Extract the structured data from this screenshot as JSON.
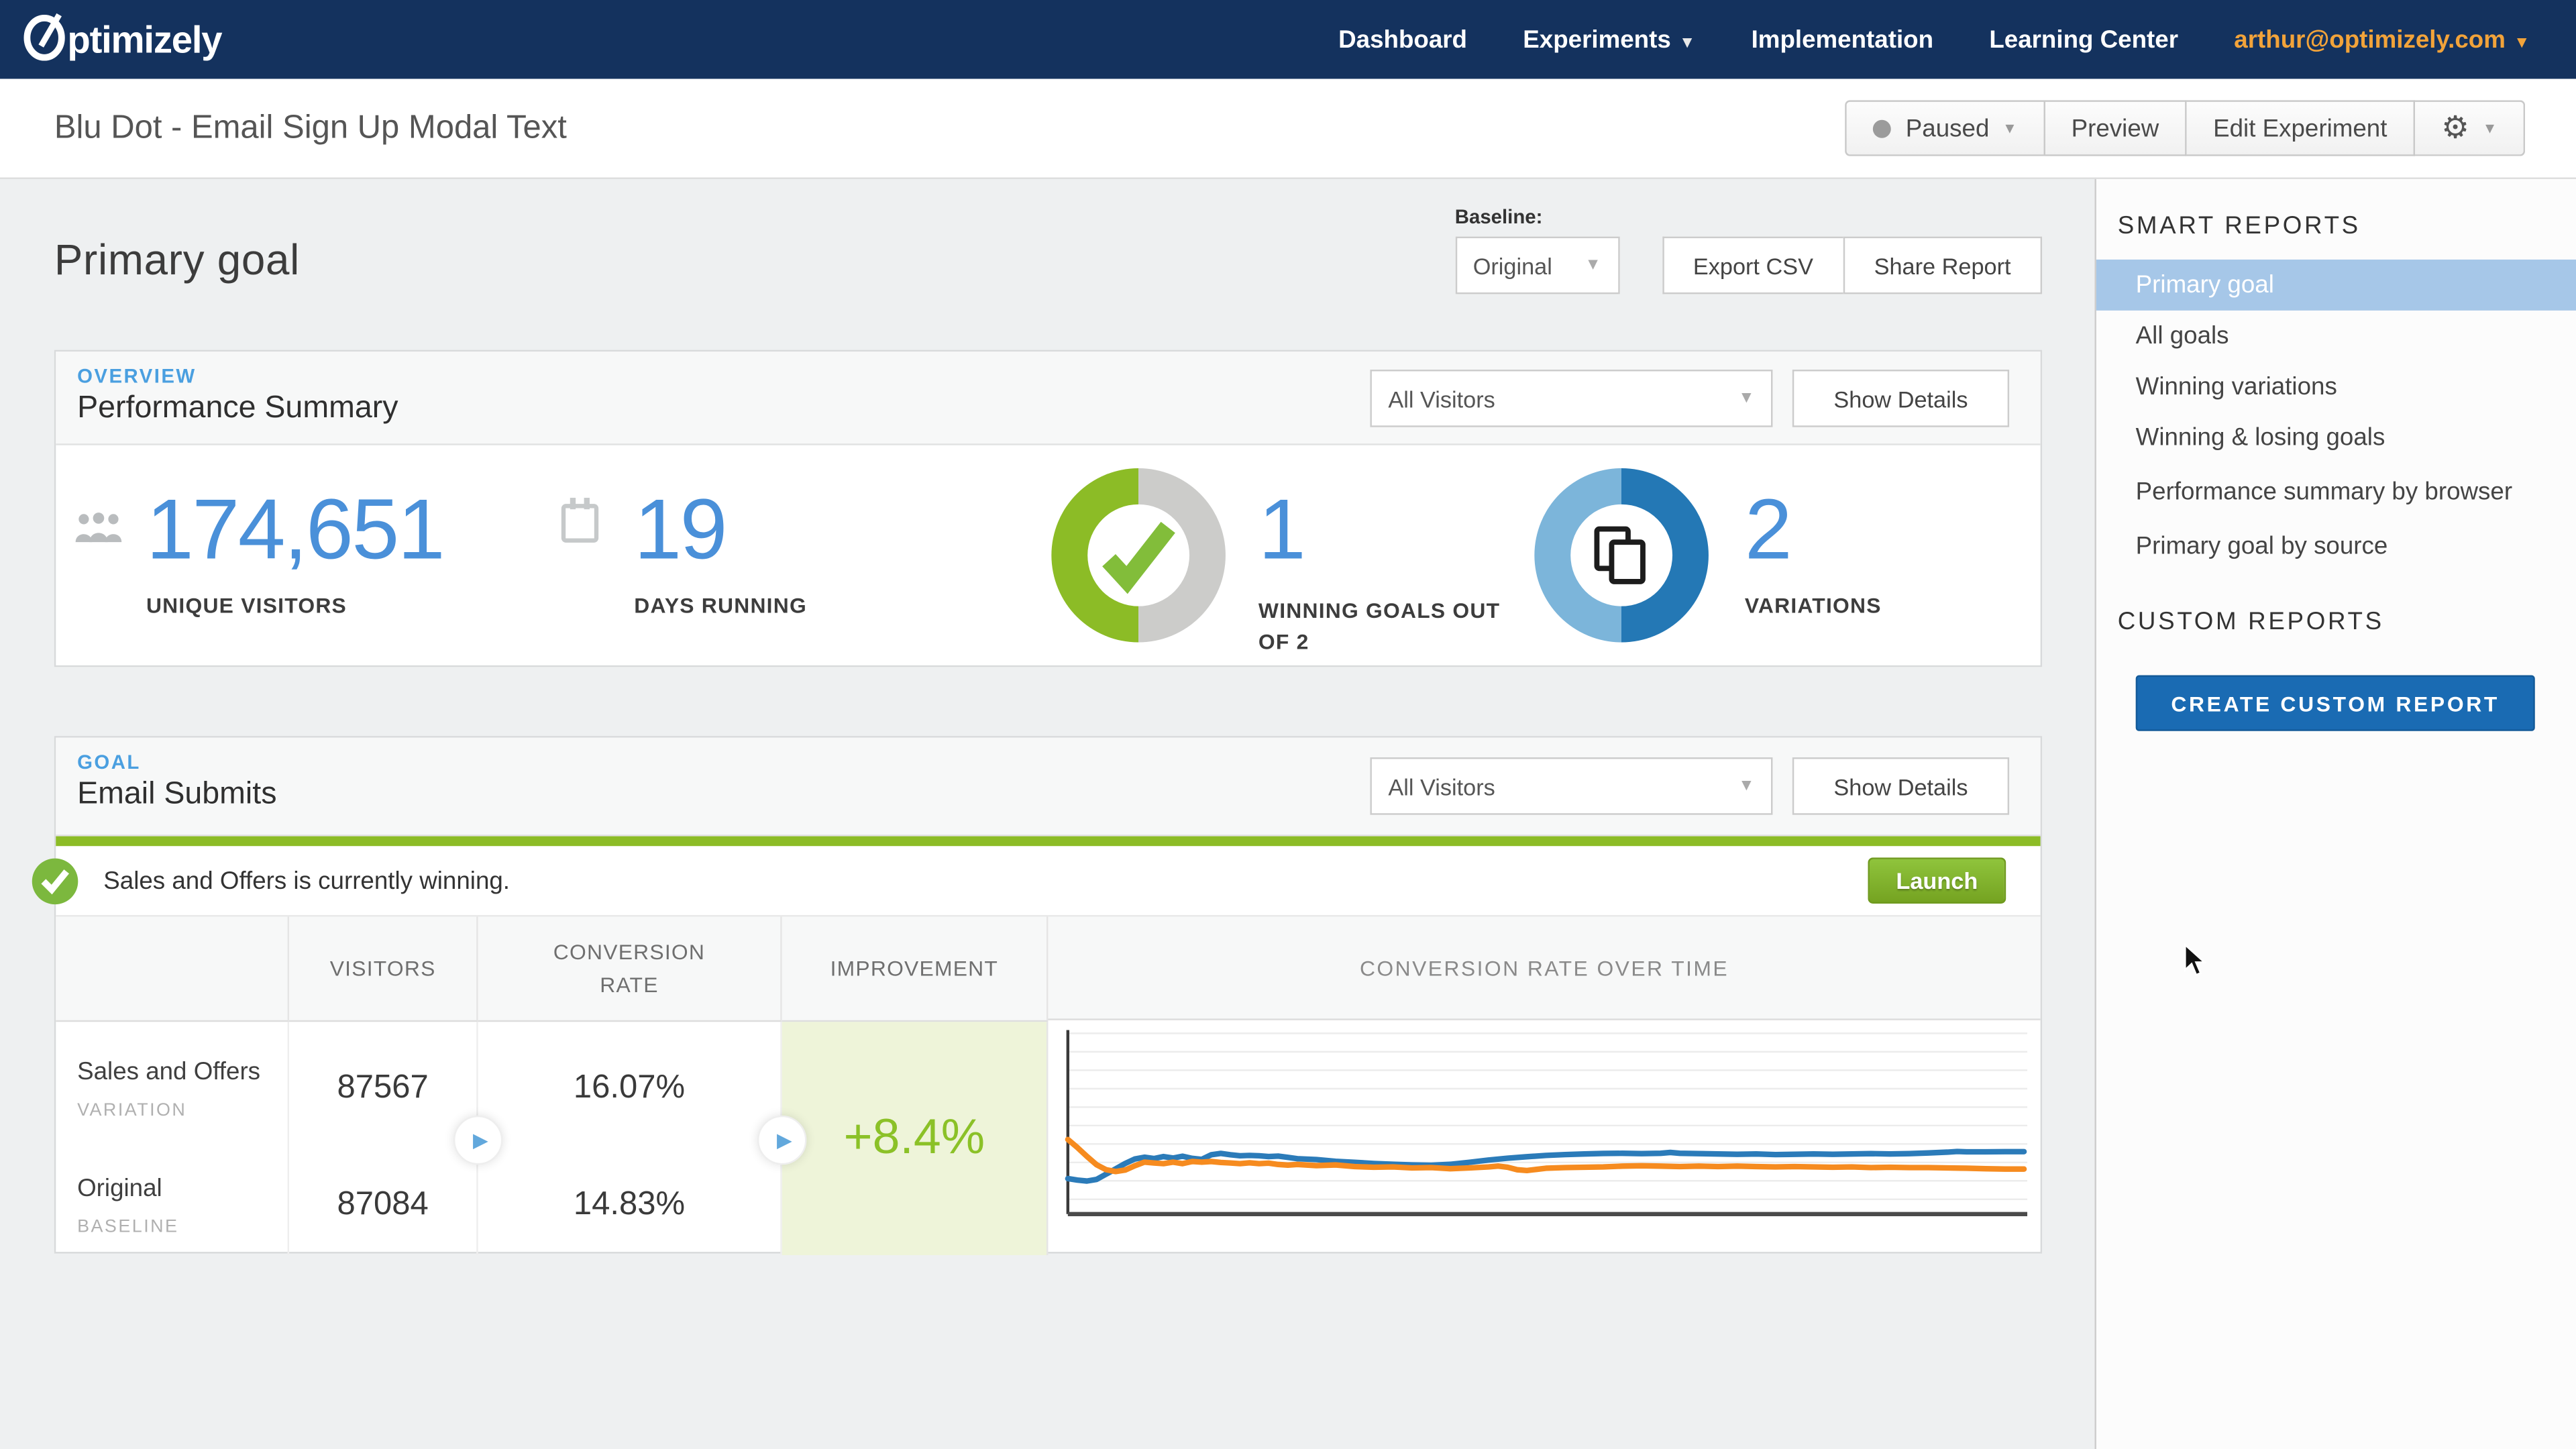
{
  "colors": {
    "navbar": "#14325e",
    "accent_blue": "#4a90d9",
    "eyebrow_blue": "#4a9fe0",
    "gold_link": "#f2a33a",
    "green": "#8cbc26",
    "green_improvement_bg": "#eef4d9",
    "green_improvement_text": "#8bc127",
    "chart_blue": "#2b7bb9",
    "chart_orange": "#f68b1f",
    "sidebar_selected_bg": "#a6c7e8",
    "create_button_blue": "#1a6bb3"
  },
  "topnav": {
    "logo": "Optimizely",
    "logo_rest": "ptimizely",
    "items": [
      {
        "label": "Dashboard"
      },
      {
        "label": "Experiments"
      },
      {
        "label": "Implementation"
      },
      {
        "label": "Learning Center"
      }
    ],
    "account": "arthur@optimizely.com"
  },
  "titlebar": {
    "title": "Blu Dot - Email Sign Up Modal Text",
    "status_label": "Paused",
    "preview_label": "Preview",
    "edit_label": "Edit Experiment"
  },
  "page": {
    "heading": "Primary goal",
    "baseline_label": "Baseline:",
    "baseline_value": "Original",
    "export_label": "Export CSV",
    "share_label": "Share Report"
  },
  "overview": {
    "eyebrow": "OVERVIEW",
    "title": "Performance Summary",
    "segment_value": "All Visitors",
    "details_label": "Show Details",
    "stats": [
      {
        "value": "174,651",
        "label": "UNIQUE VISITORS"
      },
      {
        "value": "19",
        "label": "DAYS RUNNING"
      },
      {
        "value": "1",
        "label": "WINNING GOALS OUT OF 2"
      },
      {
        "value": "2",
        "label": "VARIATIONS"
      }
    ]
  },
  "goal": {
    "eyebrow": "GOAL",
    "title": "Email Submits",
    "segment_value": "All Visitors",
    "details_label": "Show Details",
    "winning_message": "Sales and Offers is currently winning.",
    "launch_label": "Launch",
    "table": {
      "headers": {
        "visitors": "VISITORS",
        "conversion_rate": "CONVERSION RATE",
        "improvement": "IMPROVEMENT"
      },
      "rows": [
        {
          "name": "Sales and Offers",
          "tag": "VARIATION",
          "visitors": "87567",
          "conversion_rate": "16.07%"
        },
        {
          "name": "Original",
          "tag": "BASELINE",
          "visitors": "87084",
          "conversion_rate": "14.83%"
        }
      ],
      "improvement_value": "+8.4%"
    }
  },
  "chart_data": {
    "type": "line",
    "title": "CONVERSION RATE OVER TIME",
    "xlabel": "",
    "ylabel": "",
    "axis_labels_visible": false,
    "gridlines": 10,
    "y_unit": "percent of plot height (no tick labels shown in UI); final cumulative rates from table: variation 16.07%, baseline 14.83%",
    "legend_position": "none",
    "series": [
      {
        "name": "Sales and Offers (variation)",
        "color": "#2b7bb9",
        "points": [
          [
            0,
            20
          ],
          [
            1,
            19.2
          ],
          [
            2,
            18.6
          ],
          [
            3,
            19.5
          ],
          [
            4,
            22.5
          ],
          [
            5,
            25.5
          ],
          [
            6,
            28.5
          ],
          [
            7,
            31
          ],
          [
            8,
            32
          ],
          [
            9,
            31.3
          ],
          [
            10,
            32.4
          ],
          [
            11,
            31.6
          ],
          [
            12,
            32.6
          ],
          [
            13,
            31.4
          ],
          [
            14,
            30.8
          ],
          [
            15,
            33.4
          ],
          [
            16,
            34.2
          ],
          [
            17,
            33.4
          ],
          [
            18,
            32.9
          ],
          [
            19,
            33.1
          ],
          [
            20,
            32.9
          ],
          [
            21,
            32.4
          ],
          [
            22,
            32.7
          ],
          [
            23,
            31.9
          ],
          [
            24,
            31.2
          ],
          [
            26,
            30.7
          ],
          [
            28,
            29.7
          ],
          [
            30,
            29.2
          ],
          [
            32,
            28.5
          ],
          [
            34,
            28.1
          ],
          [
            36,
            27.7
          ],
          [
            38,
            27.5
          ],
          [
            40,
            28.1
          ],
          [
            42,
            29.2
          ],
          [
            44,
            30.5
          ],
          [
            46,
            31.5
          ],
          [
            48,
            32.3
          ],
          [
            50,
            33.1
          ],
          [
            52,
            33.5
          ],
          [
            54,
            33.9
          ],
          [
            56,
            34.2
          ],
          [
            58,
            34.3
          ],
          [
            60,
            34.1
          ],
          [
            62,
            34.3
          ],
          [
            63,
            34.7
          ],
          [
            64,
            34.3
          ],
          [
            66,
            34.1
          ],
          [
            68,
            33.9
          ],
          [
            70,
            33.7
          ],
          [
            72,
            33.9
          ],
          [
            74,
            33.5
          ],
          [
            76,
            33.7
          ],
          [
            78,
            33.9
          ],
          [
            80,
            33.7
          ],
          [
            82,
            33.9
          ],
          [
            84,
            34.1
          ],
          [
            86,
            33.9
          ],
          [
            88,
            34.1
          ],
          [
            90,
            34.4
          ],
          [
            92,
            34.9
          ],
          [
            93,
            35.3
          ],
          [
            94,
            35.1
          ],
          [
            96,
            35.1
          ],
          [
            98,
            35.2
          ],
          [
            100,
            35.2
          ]
        ]
      },
      {
        "name": "Original (baseline)",
        "color": "#f68b1f",
        "points": [
          [
            0,
            42
          ],
          [
            1,
            37.5
          ],
          [
            2,
            32.5
          ],
          [
            3,
            27.8
          ],
          [
            4,
            25
          ],
          [
            5,
            24
          ],
          [
            6,
            24.8
          ],
          [
            7,
            27.2
          ],
          [
            8,
            29.3
          ],
          [
            9,
            28.8
          ],
          [
            10,
            28.4
          ],
          [
            11,
            29.3
          ],
          [
            12,
            28.4
          ],
          [
            13,
            29.6
          ],
          [
            14,
            29.3
          ],
          [
            15,
            29.6
          ],
          [
            16,
            29.1
          ],
          [
            17,
            28.8
          ],
          [
            18,
            28.4
          ],
          [
            19,
            28.9
          ],
          [
            20,
            28.4
          ],
          [
            21,
            28.7
          ],
          [
            22,
            28
          ],
          [
            23,
            27.6
          ],
          [
            24,
            28
          ],
          [
            26,
            27.3
          ],
          [
            28,
            27.7
          ],
          [
            30,
            26.8
          ],
          [
            32,
            26.4
          ],
          [
            34,
            26.6
          ],
          [
            36,
            26
          ],
          [
            38,
            26.2
          ],
          [
            40,
            25.6
          ],
          [
            42,
            26
          ],
          [
            44,
            26.6
          ],
          [
            45,
            27
          ],
          [
            46,
            26.4
          ],
          [
            47,
            25
          ],
          [
            48,
            24.5
          ],
          [
            49,
            25.2
          ],
          [
            50,
            25.8
          ],
          [
            52,
            26.2
          ],
          [
            54,
            26.4
          ],
          [
            56,
            26.6
          ],
          [
            58,
            27
          ],
          [
            60,
            27.2
          ],
          [
            62,
            27
          ],
          [
            64,
            26.8
          ],
          [
            66,
            27
          ],
          [
            68,
            26.8
          ],
          [
            70,
            27
          ],
          [
            72,
            26.8
          ],
          [
            74,
            26.6
          ],
          [
            76,
            26.8
          ],
          [
            78,
            26.6
          ],
          [
            80,
            26.4
          ],
          [
            82,
            26.6
          ],
          [
            84,
            26.2
          ],
          [
            86,
            26.4
          ],
          [
            88,
            26.2
          ],
          [
            90,
            26.2
          ],
          [
            92,
            26
          ],
          [
            94,
            25.8
          ],
          [
            96,
            25.6
          ],
          [
            98,
            25.4
          ],
          [
            100,
            25.4
          ]
        ]
      }
    ]
  },
  "sidebar": {
    "smart_header": "SMART REPORTS",
    "items": [
      {
        "label": "Primary goal",
        "selected": true
      },
      {
        "label": "All goals"
      },
      {
        "label": "Winning variations"
      },
      {
        "label": "Winning & losing goals"
      },
      {
        "label": "Performance summary by browser"
      },
      {
        "label": "Primary goal by source"
      }
    ],
    "custom_header": "CUSTOM REPORTS",
    "create_label": "CREATE CUSTOM REPORT"
  }
}
